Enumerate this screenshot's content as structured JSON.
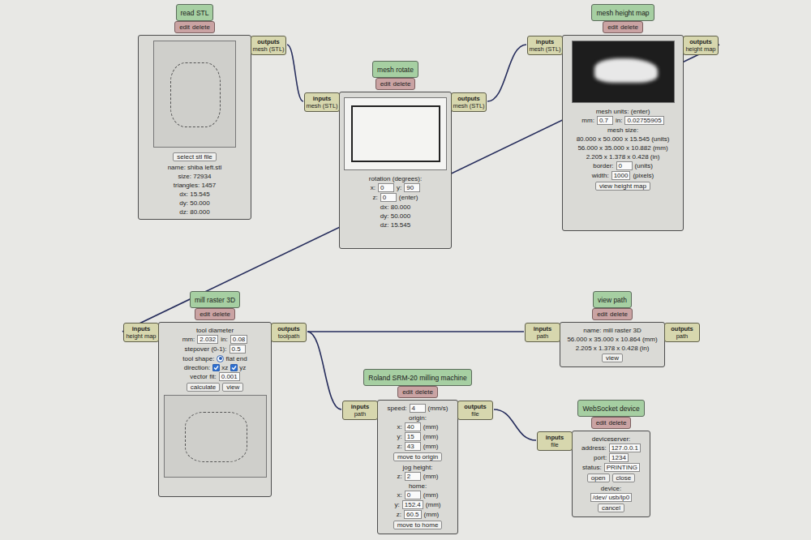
{
  "nodes": [
    {
      "title": "read STL",
      "actions": [
        "edit",
        "delete"
      ],
      "outputs": {
        "heading": "outputs",
        "type": "mesh (STL)"
      },
      "rows": [
        {
          "kind": "image",
          "shade": "light"
        },
        {
          "kind": "line",
          "parts": [
            {
              "kind": "button",
              "text": "select stl file"
            }
          ]
        },
        {
          "kind": "line",
          "parts": [
            {
              "kind": "label",
              "text": "name: shiba left.stl"
            }
          ]
        },
        {
          "kind": "line",
          "parts": [
            {
              "kind": "label",
              "text": "size: 72934"
            }
          ]
        },
        {
          "kind": "line",
          "parts": [
            {
              "kind": "label",
              "text": "triangles: 1457"
            }
          ]
        },
        {
          "kind": "line",
          "parts": [
            {
              "kind": "label",
              "text": "dx: 15.545"
            }
          ]
        },
        {
          "kind": "line",
          "parts": [
            {
              "kind": "label",
              "text": "dy: 50.000"
            }
          ]
        },
        {
          "kind": "line",
          "parts": [
            {
              "kind": "label",
              "text": "dz: 80.000"
            }
          ]
        }
      ]
    },
    {
      "title": "mesh rotate",
      "actions": [
        "edit",
        "delete"
      ],
      "inputs": {
        "heading": "inputs",
        "type": "mesh (STL)"
      },
      "outputs": {
        "heading": "outputs",
        "type": "mesh (STL)"
      },
      "rows": [
        {
          "kind": "image",
          "shade": "white"
        },
        {
          "kind": "line",
          "parts": [
            {
              "kind": "label",
              "text": "rotation (degrees):"
            }
          ]
        },
        {
          "kind": "line",
          "parts": [
            {
              "kind": "label",
              "text": "x:"
            },
            {
              "kind": "field",
              "value": "0"
            },
            {
              "kind": "label",
              "text": "y:"
            },
            {
              "kind": "field",
              "value": "90"
            }
          ]
        },
        {
          "kind": "line",
          "parts": [
            {
              "kind": "label",
              "text": "z:"
            },
            {
              "kind": "field",
              "value": "0"
            },
            {
              "kind": "label",
              "text": "(enter)"
            }
          ]
        },
        {
          "kind": "line",
          "parts": [
            {
              "kind": "label",
              "text": "dx: 80.000"
            }
          ]
        },
        {
          "kind": "line",
          "parts": [
            {
              "kind": "label",
              "text": "dy: 50.000"
            }
          ]
        },
        {
          "kind": "line",
          "parts": [
            {
              "kind": "label",
              "text": "dz: 15.545"
            }
          ]
        }
      ]
    },
    {
      "title": "mesh height map",
      "actions": [
        "edit",
        "delete"
      ],
      "inputs": {
        "heading": "inputs",
        "type": "mesh (STL)"
      },
      "outputs": {
        "heading": "outputs",
        "type": "height map"
      },
      "rows": [
        {
          "kind": "image",
          "shade": "dark"
        },
        {
          "kind": "line",
          "parts": [
            {
              "kind": "label",
              "text": "mesh units: (enter)"
            }
          ]
        },
        {
          "kind": "line",
          "parts": [
            {
              "kind": "label",
              "text": "mm:"
            },
            {
              "kind": "field",
              "value": "0.7"
            },
            {
              "kind": "label",
              "text": "in:"
            },
            {
              "kind": "field",
              "value": "0.02755905"
            }
          ]
        },
        {
          "kind": "line",
          "parts": [
            {
              "kind": "label",
              "text": "mesh size:"
            }
          ]
        },
        {
          "kind": "line",
          "parts": [
            {
              "kind": "label",
              "text": "80.000 x 50.000 x 15.545 (units)"
            }
          ]
        },
        {
          "kind": "line",
          "parts": [
            {
              "kind": "label",
              "text": "56.000 x 35.000 x 10.882 (mm)"
            }
          ]
        },
        {
          "kind": "line",
          "parts": [
            {
              "kind": "label",
              "text": "2.205 x 1.378 x 0.428 (in)"
            }
          ]
        },
        {
          "kind": "line",
          "parts": [
            {
              "kind": "label",
              "text": "border:"
            },
            {
              "kind": "field",
              "value": "0"
            },
            {
              "kind": "label",
              "text": "(units)"
            }
          ]
        },
        {
          "kind": "line",
          "parts": [
            {
              "kind": "label",
              "text": "width:"
            },
            {
              "kind": "field",
              "value": "1000"
            },
            {
              "kind": "label",
              "text": "(pixels)"
            }
          ]
        },
        {
          "kind": "line",
          "parts": [
            {
              "kind": "button",
              "text": "view height map"
            }
          ]
        }
      ]
    },
    {
      "title": "mill raster 3D",
      "actions": [
        "edit",
        "delete"
      ],
      "inputs": {
        "heading": "inputs",
        "type": "height map"
      },
      "outputs": {
        "heading": "outputs",
        "type": "toolpath"
      },
      "rows": [
        {
          "kind": "line",
          "parts": [
            {
              "kind": "label",
              "text": "tool diameter"
            }
          ]
        },
        {
          "kind": "line",
          "parts": [
            {
              "kind": "label",
              "text": "mm:"
            },
            {
              "kind": "field",
              "value": "2.032"
            },
            {
              "kind": "label",
              "text": "in:"
            },
            {
              "kind": "field",
              "value": "0.08"
            }
          ]
        },
        {
          "kind": "line",
          "parts": [
            {
              "kind": "label",
              "text": "stepover (0-1):"
            },
            {
              "kind": "field",
              "value": "0.5"
            }
          ]
        },
        {
          "kind": "line",
          "parts": [
            {
              "kind": "label",
              "text": "tool shape:"
            },
            {
              "kind": "radio",
              "label": "flat end",
              "selected": true
            }
          ]
        },
        {
          "kind": "line",
          "parts": [
            {
              "kind": "label",
              "text": "direction:"
            },
            {
              "kind": "checkbox",
              "label": "xz",
              "checked": true
            },
            {
              "kind": "checkbox",
              "label": "yz",
              "checked": true
            }
          ]
        },
        {
          "kind": "line",
          "parts": [
            {
              "kind": "label",
              "text": "vector fit:"
            },
            {
              "kind": "field",
              "value": "0.001"
            }
          ]
        },
        {
          "kind": "line",
          "parts": [
            {
              "kind": "button",
              "text": "calculate"
            },
            {
              "kind": "button",
              "text": "view"
            }
          ]
        },
        {
          "kind": "image",
          "shade": "light"
        }
      ]
    },
    {
      "title": "view path",
      "actions": [
        "edit",
        "delete"
      ],
      "inputs": {
        "heading": "inputs",
        "type": "path"
      },
      "outputs": {
        "heading": "outputs",
        "type": "path"
      },
      "rows": [
        {
          "kind": "line",
          "parts": [
            {
              "kind": "label",
              "text": "name: mill raster 3D"
            }
          ]
        },
        {
          "kind": "line",
          "parts": [
            {
              "kind": "label",
              "text": "56.000 x 35.000 x 10.864 (mm)"
            }
          ]
        },
        {
          "kind": "line",
          "parts": [
            {
              "kind": "label",
              "text": "2.205 x 1.378 x 0.428 (in)"
            }
          ]
        },
        {
          "kind": "line",
          "parts": [
            {
              "kind": "button",
              "text": "view"
            }
          ]
        }
      ]
    },
    {
      "title": "Roland SRM-20 milling machine",
      "actions": [
        "edit",
        "delete"
      ],
      "inputs": {
        "heading": "inputs",
        "type": "path"
      },
      "outputs": {
        "heading": "outputs",
        "type": "file"
      },
      "rows": [
        {
          "kind": "line",
          "parts": [
            {
              "kind": "label",
              "text": "speed:"
            },
            {
              "kind": "field",
              "value": "4"
            },
            {
              "kind": "label",
              "text": "(mm/s)"
            }
          ]
        },
        {
          "kind": "line",
          "parts": [
            {
              "kind": "label",
              "text": "origin:"
            }
          ]
        },
        {
          "kind": "line",
          "parts": [
            {
              "kind": "label",
              "text": "x:"
            },
            {
              "kind": "field",
              "value": "40"
            },
            {
              "kind": "label",
              "text": "(mm)"
            }
          ]
        },
        {
          "kind": "line",
          "parts": [
            {
              "kind": "label",
              "text": "y:"
            },
            {
              "kind": "field",
              "value": "15"
            },
            {
              "kind": "label",
              "text": "(mm)"
            }
          ]
        },
        {
          "kind": "line",
          "parts": [
            {
              "kind": "label",
              "text": "z:"
            },
            {
              "kind": "field",
              "value": "43"
            },
            {
              "kind": "label",
              "text": "(mm)"
            }
          ]
        },
        {
          "kind": "line",
          "parts": [
            {
              "kind": "button",
              "text": "move to origin"
            }
          ]
        },
        {
          "kind": "line",
          "parts": [
            {
              "kind": "label",
              "text": "jog height:"
            }
          ]
        },
        {
          "kind": "line",
          "parts": [
            {
              "kind": "label",
              "text": "z:"
            },
            {
              "kind": "field",
              "value": "2"
            },
            {
              "kind": "label",
              "text": "(mm)"
            }
          ]
        },
        {
          "kind": "line",
          "parts": [
            {
              "kind": "label",
              "text": "home:"
            }
          ]
        },
        {
          "kind": "line",
          "parts": [
            {
              "kind": "label",
              "text": "x:"
            },
            {
              "kind": "field",
              "value": "0"
            },
            {
              "kind": "label",
              "text": "(mm)"
            }
          ]
        },
        {
          "kind": "line",
          "parts": [
            {
              "kind": "label",
              "text": "y:"
            },
            {
              "kind": "field",
              "value": "152.4"
            },
            {
              "kind": "label",
              "text": "(mm)"
            }
          ]
        },
        {
          "kind": "line",
          "parts": [
            {
              "kind": "label",
              "text": "z:"
            },
            {
              "kind": "field",
              "value": "60.5"
            },
            {
              "kind": "label",
              "text": "(mm)"
            }
          ]
        },
        {
          "kind": "line",
          "parts": [
            {
              "kind": "button",
              "text": "move to home"
            }
          ]
        }
      ]
    },
    {
      "title": "WebSocket device",
      "actions": [
        "edit",
        "delete"
      ],
      "inputs": {
        "heading": "inputs",
        "type": "file"
      },
      "rows": [
        {
          "kind": "line",
          "parts": [
            {
              "kind": "label",
              "text": "deviceserver:"
            }
          ]
        },
        {
          "kind": "line",
          "parts": [
            {
              "kind": "label",
              "text": "address:"
            },
            {
              "kind": "field",
              "value": "127.0.0.1"
            }
          ]
        },
        {
          "kind": "line",
          "parts": [
            {
              "kind": "label",
              "text": "port:"
            },
            {
              "kind": "field",
              "value": "1234"
            }
          ]
        },
        {
          "kind": "line",
          "parts": [
            {
              "kind": "label",
              "text": "status:"
            },
            {
              "kind": "field",
              "value": "PRINTING"
            }
          ]
        },
        {
          "kind": "line",
          "parts": [
            {
              "kind": "button",
              "text": "open"
            },
            {
              "kind": "button",
              "text": "close"
            }
          ]
        },
        {
          "kind": "line",
          "parts": [
            {
              "kind": "label",
              "text": "device:"
            }
          ]
        },
        {
          "kind": "line",
          "parts": [
            {
              "kind": "field",
              "value": "/dev/ usb/lp0"
            }
          ]
        },
        {
          "kind": "line",
          "parts": [
            {
              "kind": "button",
              "text": "cancel"
            }
          ]
        }
      ]
    }
  ],
  "links": [
    {
      "from": 0,
      "to": 1
    },
    {
      "from": 1,
      "to": 2
    },
    {
      "from": 2,
      "to": 3
    },
    {
      "from": 3,
      "to": 4
    },
    {
      "from": 3,
      "to": 5
    },
    {
      "from": 5,
      "to": 6
    }
  ]
}
